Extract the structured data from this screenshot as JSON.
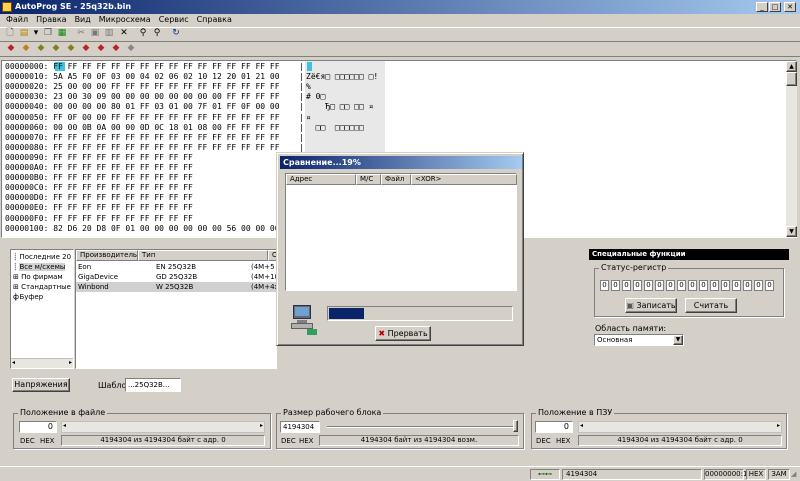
{
  "window": {
    "title": "AutoProg SE - 25q32b.bin",
    "min": "_",
    "max": "□",
    "close": "✕"
  },
  "menu": [
    "Файл",
    "Правка",
    "Вид",
    "Микросхема",
    "Сервис",
    "Справка"
  ],
  "hex_rows": [
    {
      "addr": "00000000:",
      "bytes": "FF FF FF FF FF FF FF FF FF FF FF FF FF FF FF FF",
      "ascii": ""
    },
    {
      "addr": "00000010:",
      "bytes": "5A A5 F0 0F 03 00 04 02 06 02 10 12 20 01 21 00",
      "ascii": "Zё€я□ □□□□□□ □!"
    },
    {
      "addr": "00000020:",
      "bytes": "25 00 00 00 FF FF FF FF FF FF FF FF FF FF FF FF",
      "ascii": "%"
    },
    {
      "addr": "00000030:",
      "bytes": "23 00 30 09 00 00 00 00 00 00 00 00 FF FF FF FF",
      "ascii": "# 0□"
    },
    {
      "addr": "00000040:",
      "bytes": "00 00 00 00 80 01 FF 03 01 00 7F 01 FF 0F 00 00",
      "ascii": "    Ђ□ □□ □□ ¤"
    },
    {
      "addr": "00000050:",
      "bytes": "FF 0F 00 00 FF FF FF FF FF FF FF FF FF FF FF FF",
      "ascii": "¤"
    },
    {
      "addr": "00000060:",
      "bytes": "00 00 0B 0A 00 00 0D 0C 18 01 08 00 FF FF FF FF",
      "ascii": "  □□  □□□□□□"
    },
    {
      "addr": "00000070:",
      "bytes": "FF FF FF FF FF FF FF FF FF FF FF FF FF FF FF FF",
      "ascii": ""
    },
    {
      "addr": "00000080:",
      "bytes": "FF FF FF FF FF FF FF FF FF FF FF FF FF FF FF FF",
      "ascii": ""
    },
    {
      "addr": "00000090:",
      "bytes": "FF FF FF FF FF FF FF FF FF FF",
      "ascii": ""
    },
    {
      "addr": "000000A0:",
      "bytes": "FF FF FF FF FF FF FF FF FF FF",
      "ascii": ""
    },
    {
      "addr": "000000B0:",
      "bytes": "FF FF FF FF FF FF FF FF FF FF",
      "ascii": ""
    },
    {
      "addr": "000000C0:",
      "bytes": "FF FF FF FF FF FF FF FF FF FF",
      "ascii": ""
    },
    {
      "addr": "000000D0:",
      "bytes": "FF FF FF FF FF FF FF FF FF FF",
      "ascii": ""
    },
    {
      "addr": "000000E0:",
      "bytes": "FF FF FF FF FF FF FF FF FF FF",
      "ascii": ""
    },
    {
      "addr": "000000F0:",
      "bytes": "FF FF FF FF FF FF FF FF FF FF",
      "ascii": ""
    },
    {
      "addr": "00000100:",
      "bytes": "82 D6 20 D8 0F 01 00 00 00 00 00 00 56 00 00 00",
      "ascii": ""
    }
  ],
  "tree": [
    "Последние 20",
    "Все м/схемы",
    "По фирмам",
    "Стандартные ф",
    "Буфер"
  ],
  "chips": {
    "headers": [
      "Производитель",
      "Тип",
      "О"
    ],
    "rows": [
      [
        "Eon",
        "EN 25Q32B",
        "(4M+5"
      ],
      [
        "GigaDevice",
        "GD 25Q32B",
        "(4M+10"
      ],
      [
        "Winbond",
        "W 25Q32B",
        "(4M+4x2"
      ]
    ]
  },
  "left_bottom": {
    "voltage": "Напряжения",
    "template_label": "Шаблон",
    "template_value": "...25Q32B..."
  },
  "special": {
    "title": "Специальные функции",
    "status_label": "Статус-регистр",
    "bits": [
      "0",
      "0",
      "0",
      "0",
      "0",
      "0",
      "0",
      "0",
      "0",
      "0",
      "0",
      "0",
      "0",
      "0",
      "0",
      "0"
    ],
    "write": "Записать",
    "read": "Считать",
    "mem_label": "Область памяти:",
    "mem_value": "Основная"
  },
  "dialog": {
    "title": "Сравнение...19%",
    "headers": [
      "Адрес",
      "М/С",
      "Файл",
      "<XOR>"
    ],
    "progress": 0.19,
    "abort": "Прервать"
  },
  "pos_file": {
    "label": "Положение в файле",
    "value": "0",
    "dec": "DEC",
    "hex": "HEX",
    "info": "4194304 из 4194304 байт с адр. 0"
  },
  "block_size": {
    "label": "Размер рабочего блока",
    "value": "4194304",
    "dec": "DEC",
    "hex": "HEX",
    "info": "4194304 байт из 4194304 возм."
  },
  "pos_rom": {
    "label": "Положение в ПЗУ",
    "value": "0",
    "dec": "DEC",
    "hex": "HEX",
    "info": "4194304 из 4194304 байт с адр. 0"
  },
  "status": {
    "size": "4194304",
    "offset": "00000000:1",
    "mode": "HEX",
    "ins": "ЗАМ"
  }
}
